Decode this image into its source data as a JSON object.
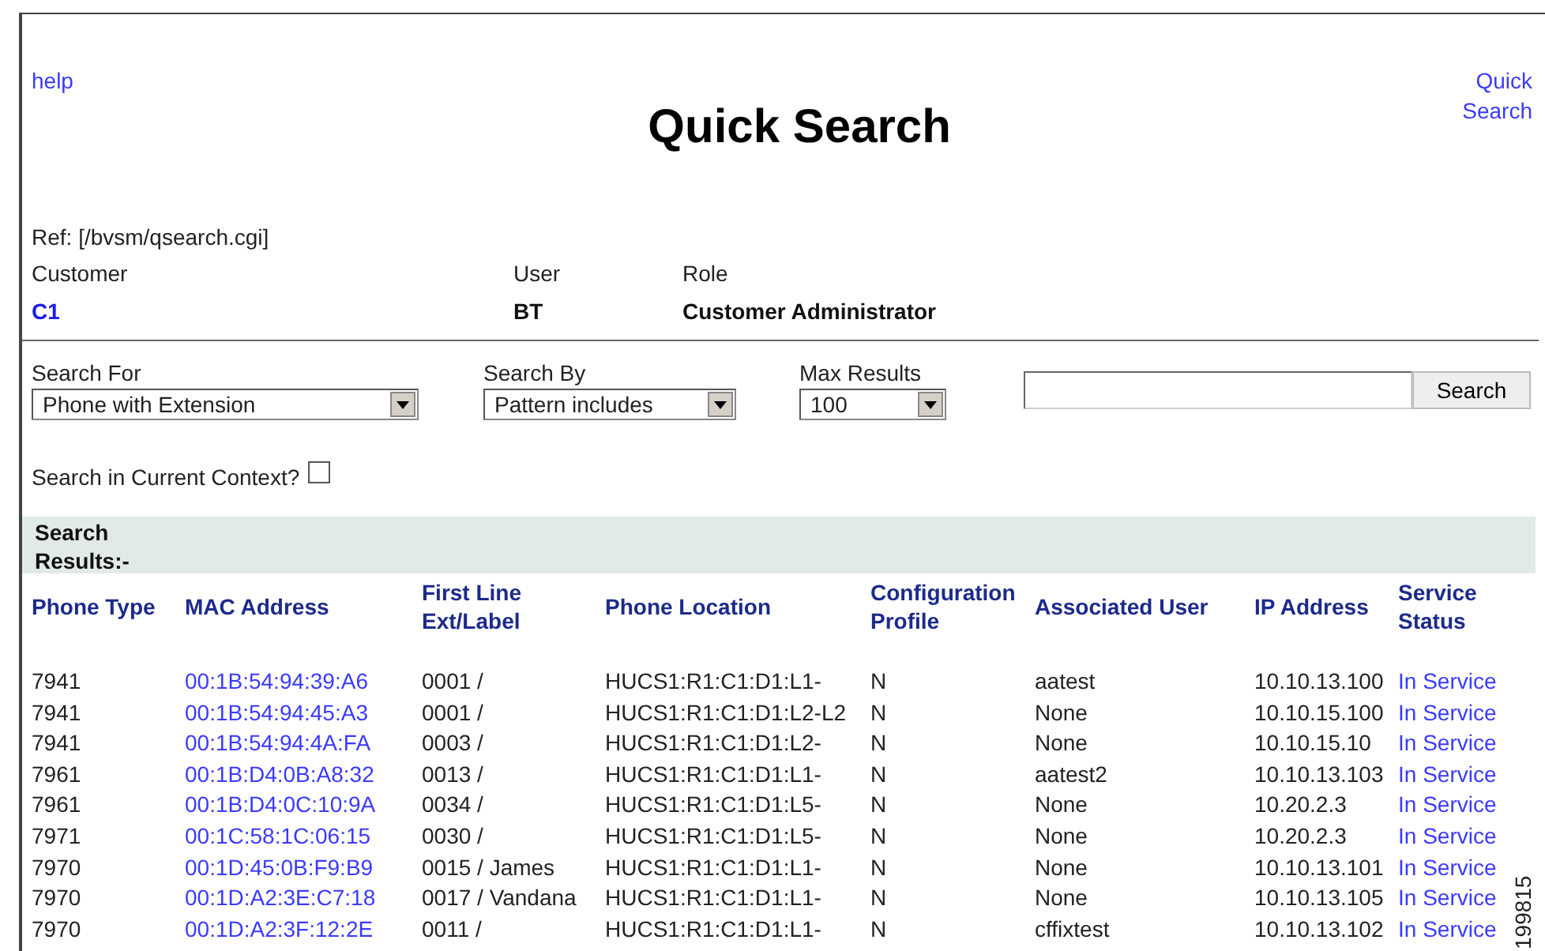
{
  "help_link": "help",
  "title": "Quick Search",
  "quick_search_link": [
    "Quick",
    "Search"
  ],
  "ref": "Ref: [/bvsm/qsearch.cgi]",
  "context": [
    {
      "label": "Customer",
      "value": "C1",
      "kind": "link"
    },
    {
      "label": "User",
      "value": "BT",
      "kind": "text"
    },
    {
      "label": "Role",
      "value": "Customer Administrator",
      "kind": "text"
    }
  ],
  "filters": [
    {
      "label": "Search For",
      "value": "Phone with Extension"
    },
    {
      "label": "Search By",
      "value": "Pattern includes"
    },
    {
      "label": "Max Results",
      "value": "100"
    }
  ],
  "search_button": "Search",
  "current_context": {
    "label": "Search in Current Context?",
    "checked": false
  },
  "results_heading": [
    "Search",
    "Results:-"
  ],
  "table": {
    "columns": [
      "Phone Type",
      "MAC Address",
      "First Line\nExt/Label",
      "Phone Location",
      "Configuration\nProfile",
      "Associated User",
      "IP Address",
      "Service\nStatus"
    ],
    "rows": [
      [
        "7941",
        "00:1B:54:94:39:A6",
        "0001 /",
        "HUCS1:R1:C1:D1:L1-",
        "N",
        "aatest",
        "10.10.13.100",
        "In Service"
      ],
      [
        "7941",
        "00:1B:54:94:45:A3",
        "0001 /",
        "HUCS1:R1:C1:D1:L2-L2",
        "N",
        "None",
        "10.10.15.100",
        "In Service"
      ],
      [
        "7941",
        "00:1B:54:94:4A:FA",
        "0003 /",
        "HUCS1:R1:C1:D1:L2-",
        "N",
        "None",
        "10.10.15.10",
        "In Service"
      ],
      [
        "7961",
        "00:1B:D4:0B:A8:32",
        "0013 /",
        "HUCS1:R1:C1:D1:L1-",
        "N",
        "aatest2",
        "10.10.13.103",
        "In Service"
      ],
      [
        "7961",
        "00:1B:D4:0C:10:9A",
        "0034 /",
        "HUCS1:R1:C1:D1:L5-",
        "N",
        "None",
        "10.20.2.3",
        "In Service"
      ],
      [
        "7971",
        "00:1C:58:1C:06:15",
        "0030 /",
        "HUCS1:R1:C1:D1:L5-",
        "N",
        "None",
        "10.20.2.3",
        "In Service"
      ],
      [
        "7970",
        "00:1D:45:0B:F9:B9",
        "0015 / James",
        "HUCS1:R1:C1:D1:L1-",
        "N",
        "None",
        "10.10.13.101",
        "In Service"
      ],
      [
        "7970",
        "00:1D:A2:3E:C7:18",
        "0017 / Vandana",
        "HUCS1:R1:C1:D1:L1-",
        "N",
        "None",
        "10.10.13.105",
        "In Service"
      ],
      [
        "7970",
        "00:1D:A2:3F:12:2E",
        "0011 /",
        "HUCS1:R1:C1:D1:L1-",
        "N",
        "cffixtest",
        "10.10.13.102",
        "In Service"
      ]
    ]
  },
  "figure_id": "199815"
}
